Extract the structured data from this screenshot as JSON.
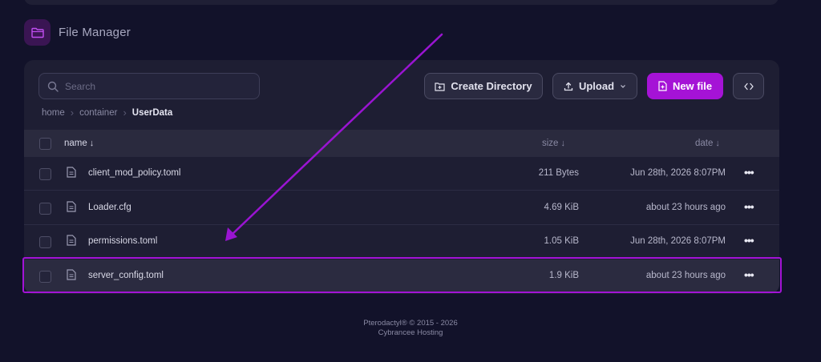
{
  "header": {
    "title": "File Manager",
    "icon": "folder-icon"
  },
  "toolbar": {
    "search_placeholder": "Search",
    "create_directory": "Create Directory",
    "upload": "Upload",
    "new_file": "New file",
    "code_icon": "code-brackets-icon"
  },
  "breadcrumb": {
    "items": [
      "home",
      "container"
    ],
    "current": "UserData"
  },
  "table": {
    "headers": {
      "name": "name",
      "size": "size",
      "date": "date"
    },
    "sort_arrow": "↓",
    "rows": [
      {
        "name": "client_mod_policy.toml",
        "size": "211 Bytes",
        "date": "Jun 28th, 2026 8:07PM"
      },
      {
        "name": "Loader.cfg",
        "size": "4.69 KiB",
        "date": "about 23 hours ago"
      },
      {
        "name": "permissions.toml",
        "size": "1.05 KiB",
        "date": "Jun 28th, 2026 8:07PM"
      },
      {
        "name": "server_config.toml",
        "size": "1.9 KiB",
        "date": "about 23 hours ago"
      }
    ],
    "more_label": "•••"
  },
  "footer": {
    "line1": "Pterodactyl® © 2015 - 2026",
    "line2": "Cybrancee Hosting"
  },
  "colors": {
    "accent": "#a513d6",
    "background": "#12122a",
    "panel": "#1e1e33"
  }
}
